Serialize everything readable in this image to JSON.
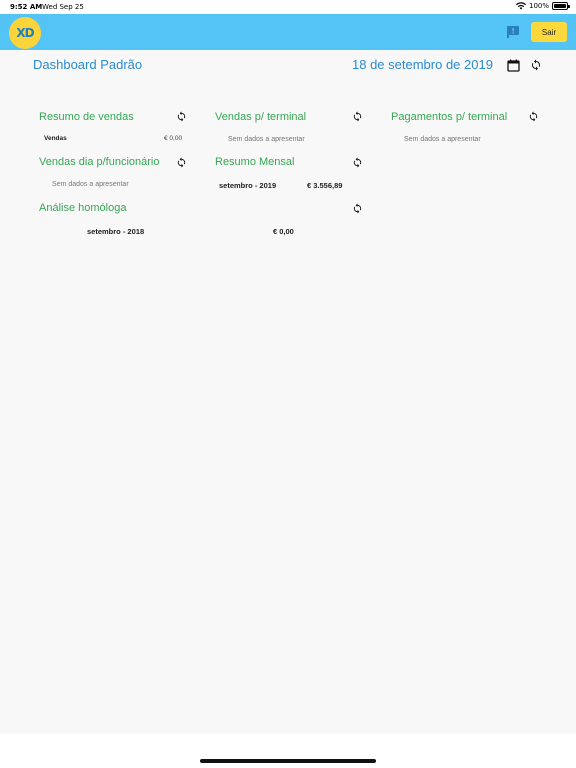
{
  "status_bar": {
    "time": "9:52 AM",
    "date": "Wed Sep 25",
    "battery": "100%"
  },
  "header": {
    "logo_text": "XD",
    "logout_label": "Sair"
  },
  "dashboard": {
    "title": "Dashboard Padrão",
    "date": "18 de setembro de 2019"
  },
  "cards": {
    "resumo_vendas": {
      "title": "Resumo de vendas",
      "row_label": "Vendas",
      "row_value": "€ 0,00"
    },
    "vendas_terminal": {
      "title": "Vendas p/ terminal",
      "empty": "Sem dados a apresentar"
    },
    "pagamentos_terminal": {
      "title": "Pagamentos p/ terminal",
      "empty": "Sem dados a apresentar"
    },
    "vendas_funcionario": {
      "title": "Vendas dia p/funcionário",
      "empty": "Sem dados a apresentar"
    },
    "resumo_mensal": {
      "title": "Resumo Mensal",
      "month": "setembro - 2019",
      "value": "€ 3.556,89"
    },
    "analise_homologa": {
      "title": "Análise homóloga",
      "month": "setembro - 2018",
      "value": "€ 0,00"
    }
  },
  "colors": {
    "header": "#54c4f7",
    "accent_blue": "#2a8bd0",
    "card_title_green": "#36a753",
    "logout_yellow": "#fbd93c"
  }
}
